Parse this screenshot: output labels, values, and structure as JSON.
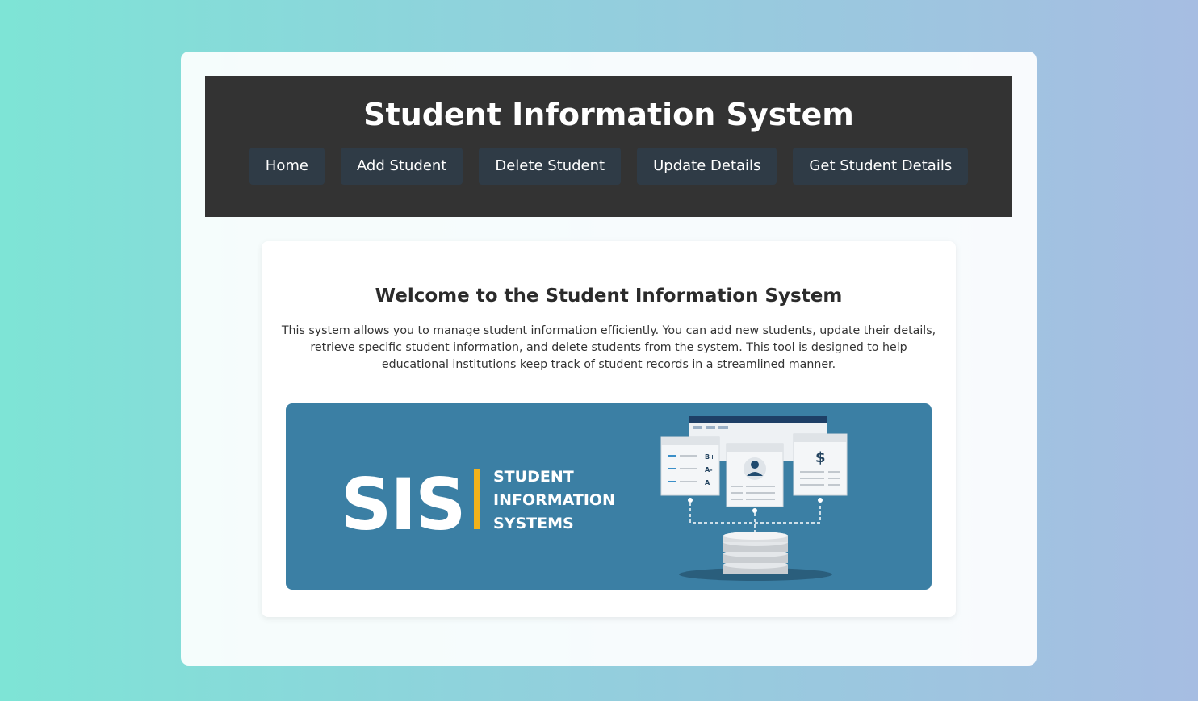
{
  "header": {
    "title": "Student Information System"
  },
  "nav": {
    "items": [
      {
        "label": "Home",
        "name": "nav-home-button"
      },
      {
        "label": "Add Student",
        "name": "nav-add-student-button"
      },
      {
        "label": "Delete Student",
        "name": "nav-delete-student-button"
      },
      {
        "label": "Update Details",
        "name": "nav-update-details-button"
      },
      {
        "label": "Get Student Details",
        "name": "nav-get-student-details-button"
      }
    ]
  },
  "welcome": {
    "heading": "Welcome to the Student Information System",
    "description": "This system allows you to manage student information efficiently. You can add new students, update their details, retrieve specific student information, and delete students from the system. This tool is designed to help educational institutions keep track of student records in a streamlined manner."
  },
  "banner": {
    "logo_text": "SIS",
    "tagline_lines": [
      "STUDENT",
      "INFORMATION",
      "SYSTEMS"
    ],
    "grades": [
      "B+",
      "A-",
      "A"
    ],
    "dollar_symbol": "$"
  },
  "colors": {
    "header_bg": "#333333",
    "nav_button_bg": "#2f3b46",
    "banner_bg": "#3b7fa4",
    "accent_bar": "#f2b21b"
  }
}
